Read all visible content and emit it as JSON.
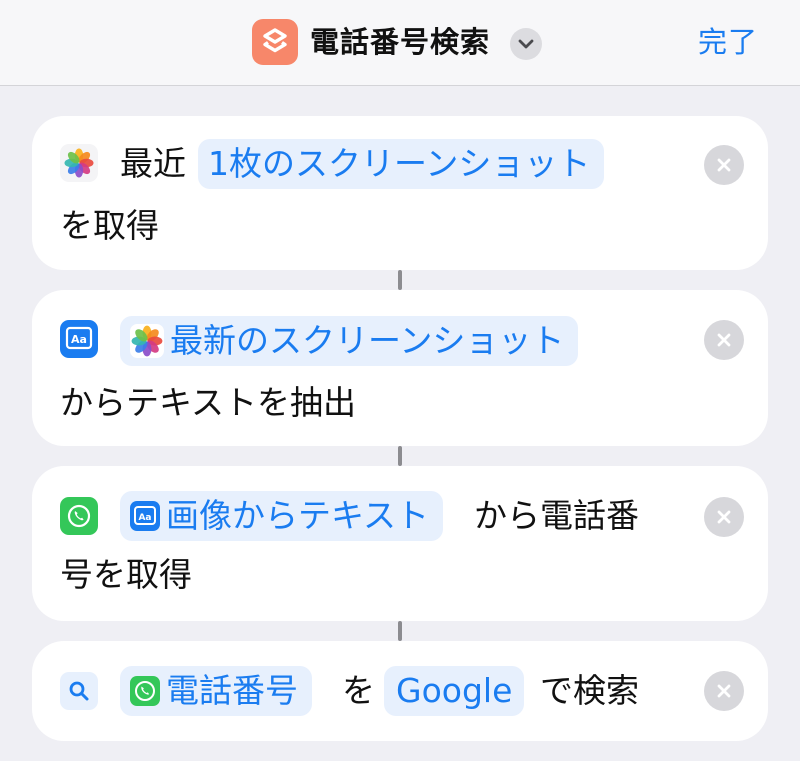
{
  "header": {
    "title": "電話番号検索",
    "done_label": "完了",
    "app_icon": "shortcuts-icon",
    "accent_color": "#1a7cf0",
    "app_icon_color": "#f7876a"
  },
  "actions": [
    {
      "icon": "photos-icon",
      "prefix": "最近",
      "token": "1枚のスクリーンショット",
      "suffix": "を取得"
    },
    {
      "icon": "text-recognition-icon",
      "token": "最新のスクリーンショット",
      "token_icon": "photos-icon",
      "suffix": "からテキストを抽出"
    },
    {
      "icon": "phone-icon",
      "token": "画像からテキスト",
      "token_icon": "text-recognition-icon",
      "suffix_line1": "から電話番",
      "suffix_line2": "号を取得"
    },
    {
      "icon": "search-icon",
      "token": "電話番号",
      "token_icon": "phone-icon",
      "middle": "を",
      "token2": "Google",
      "suffix": "で検索"
    }
  ]
}
